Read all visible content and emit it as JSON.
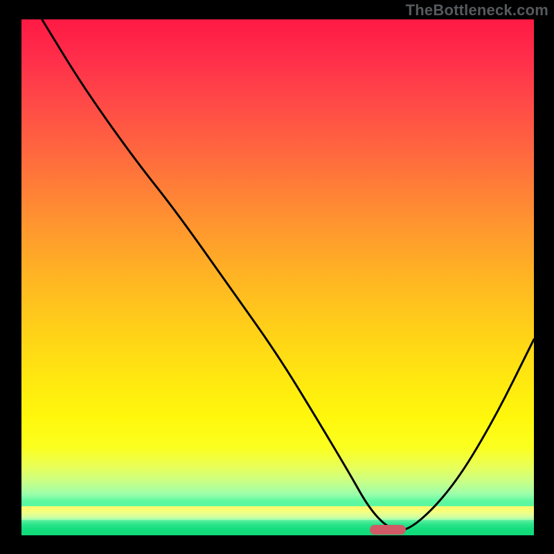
{
  "watermark": "TheBottleneck.com",
  "colors": {
    "frame": "#000000",
    "curve": "#000000",
    "marker": "#d05a66",
    "green": "#14dd7d"
  },
  "chart_data": {
    "type": "line",
    "title": "",
    "xlabel": "",
    "ylabel": "",
    "xlim": [
      0,
      100
    ],
    "ylim": [
      0,
      100
    ],
    "grid": false,
    "series": [
      {
        "name": "bottleneck-curve",
        "x": [
          4,
          12,
          22,
          30,
          40,
          50,
          58,
          64,
          68,
          72,
          76,
          84,
          92,
          100
        ],
        "y": [
          100,
          87,
          73,
          63,
          49,
          35,
          22,
          12,
          5,
          1,
          1,
          9,
          22,
          38
        ]
      }
    ],
    "optimal_marker": {
      "x_start": 68,
      "x_end": 75,
      "y": 1
    },
    "annotations": []
  }
}
